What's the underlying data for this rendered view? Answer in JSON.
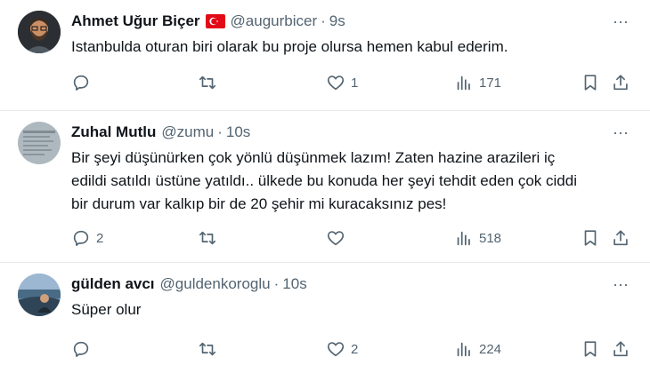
{
  "colors": {
    "text": "#0f1419",
    "muted": "#536471",
    "divider": "#e7eaed"
  },
  "tweets": [
    {
      "name": "Ahmet Uğur Biçer",
      "flag_icon": "turkey-flag-icon",
      "handle": "@augurbicer",
      "separator": "·",
      "time": "9s",
      "text": "Istanbulda oturan biri olarak bu proje olursa hemen kabul ederim.",
      "replies": "",
      "retweets": "",
      "likes": "1",
      "views": "171"
    },
    {
      "name": "Zuhal Mutlu",
      "handle": "@zumu",
      "separator": "·",
      "time": "10s",
      "text": "Bir şeyi düşünürken çok yönlü düşünmek lazım! Zaten hazine arazileri iç edildi satıldı üstüne yatıldı.. ülkede bu konuda her şeyi tehdit eden çok ciddi bir durum var kalkıp bir de 20 şehir mi kuracaksınız pes!",
      "replies": "2",
      "retweets": "",
      "likes": "",
      "views": "518"
    },
    {
      "name": "gülden avcı",
      "handle": "@guldenkoroglu",
      "separator": "·",
      "time": "10s",
      "text": "Süper olur",
      "replies": "",
      "retweets": "",
      "likes": "2",
      "views": "224"
    }
  ],
  "more_label": "···",
  "icons": [
    "more-icon",
    "reply-icon",
    "retweet-icon",
    "like-icon",
    "views-icon",
    "bookmark-icon",
    "share-icon"
  ]
}
